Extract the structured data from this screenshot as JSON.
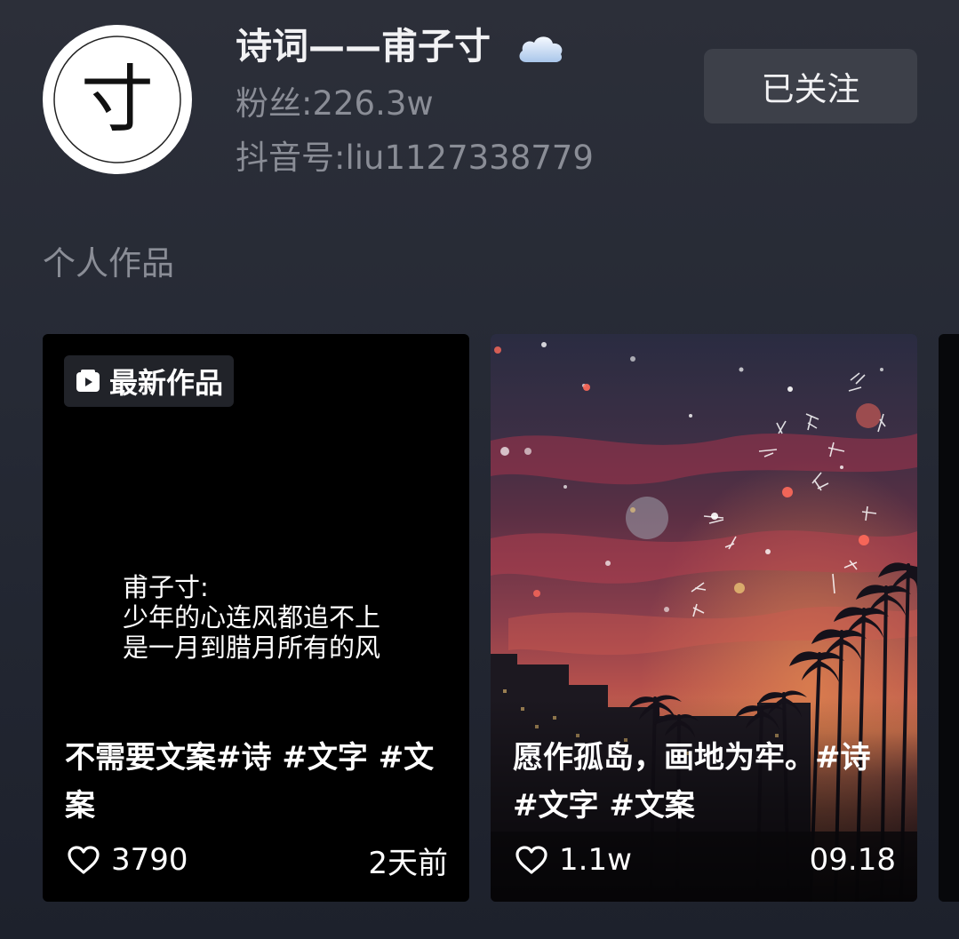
{
  "profile": {
    "avatar_char": "寸",
    "name": "诗词——甫子寸",
    "name_icon": "cloud-icon",
    "followers": "粉丝:226.3w",
    "douyin_id": "抖音号:liu1127338779",
    "follow_button_label": "已关注"
  },
  "section": {
    "title": "个人作品"
  },
  "works": [
    {
      "badge_icon": "video-icon",
      "badge": "最新作品",
      "quote_lines": [
        "甫子寸:",
        "少年的心连风都追不上",
        "是一月到腊月所有的风"
      ],
      "caption_lines": [
        "不需要文案#诗 #文字 #文",
        "案"
      ],
      "likes": "3790",
      "date": "2天前"
    },
    {
      "caption_lines": [
        "愿作孤岛，画地为牢。#诗",
        "#文字 #文案"
      ],
      "likes": "1.1w",
      "date": "09.18"
    }
  ],
  "colors": {
    "background_top": "#2c2f39",
    "background_bottom": "#1d212c",
    "secondary_text": "#8a8d96",
    "follow_button": "#3d4049"
  }
}
